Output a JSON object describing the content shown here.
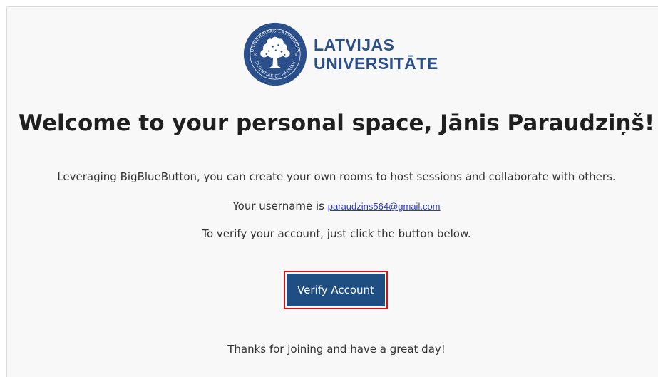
{
  "logo": {
    "name_line1": "LATVIJAS",
    "name_line2": "UNIVERSITĀTE",
    "seal_ring_top": "UNIVERSITAS LATVIENSIS",
    "seal_ring_bottom": "SCIENTIAE ET PATRIAE",
    "seal_year_left": "19",
    "seal_year_right": "19",
    "color": "#2a4f8a"
  },
  "title": "Welcome to your personal space, Jānis Paraudziņš!",
  "intro": "Leveraging BigBlueButton, you can create your own rooms to host sessions and collaborate with others.",
  "username_prefix": "Your username is ",
  "username_email": "paraudzins564@gmail.com",
  "verify_instruction": "To verify your account, just click the button below.",
  "verify_button_label": "Verify Account",
  "closing": "Thanks for joining and have a great day!",
  "colors": {
    "button_bg": "#1f4f82",
    "highlight_border": "#d0121b",
    "link": "#2a39c6"
  }
}
